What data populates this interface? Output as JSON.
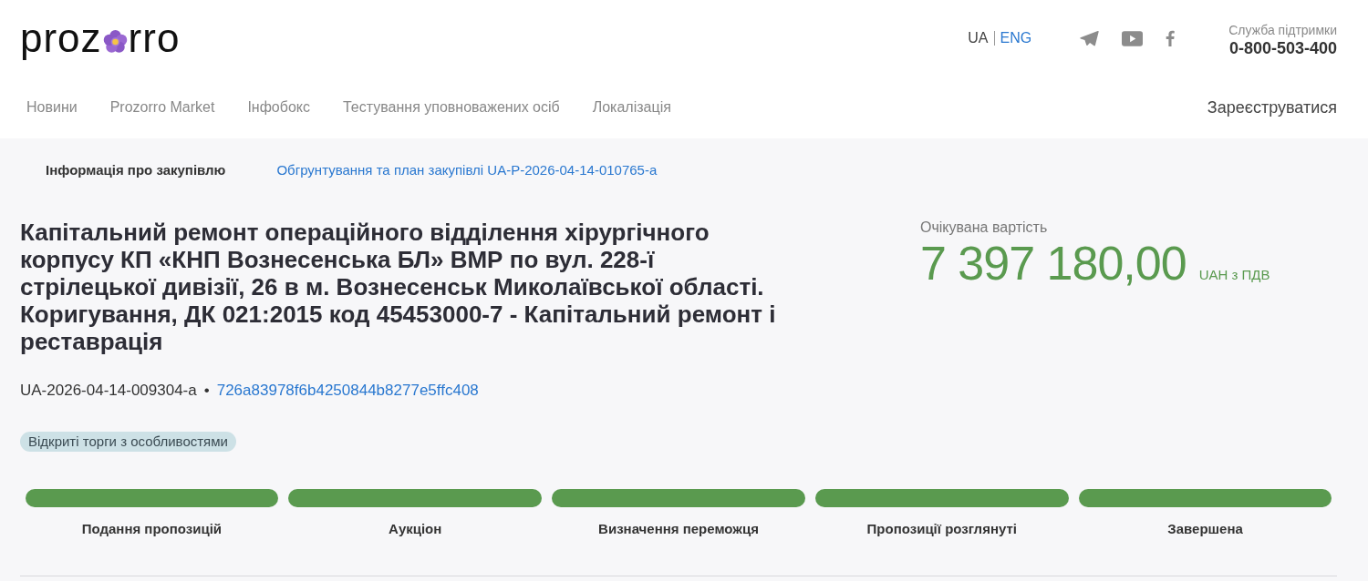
{
  "header": {
    "logo": {
      "text_start": "proz",
      "text_end": "rro"
    },
    "languages": [
      {
        "label": "UA",
        "selected": true
      },
      {
        "label": "ENG",
        "selected": false
      }
    ],
    "support": {
      "label": "Служба підтримки",
      "phone": "0-800-503-400"
    },
    "nav": [
      "Новини",
      "Prozorro Market",
      "Інфобокс",
      "Тестування уповноважених осіб",
      "Локалізація"
    ],
    "register": "Зареєструватися"
  },
  "tabs": [
    {
      "label": "Інформація про закупівлю",
      "selected": true
    },
    {
      "label": "Обгрунтування та план закупівлі UA-P-2026-04-14-010765-a",
      "selected": false
    }
  ],
  "tender": {
    "title": "Капітальний ремонт операційного відділення хірургічного корпусу КП «КНП Вознесенська БЛ» ВМР по вул. 228-ї стрілецької дивізії, 26 в м. Вознесенськ Миколаївської області. Коригування, ДК 021:2015 код 45453000-7 - Капітальний ремонт і реставрація",
    "id": "UA-2026-04-14-009304-a",
    "separator": "•",
    "hash": "726a83978f6b4250844b8277e5ffc408",
    "procedure": "Відкриті торги з особливостями"
  },
  "price": {
    "label": "Очікувана вартість",
    "amount": "7 397 180,00",
    "currency": "UAH з ПДВ"
  },
  "stages": [
    {
      "label": "Подання пропозицій",
      "done": true
    },
    {
      "label": "Аукціон",
      "done": true
    },
    {
      "label": "Визначення переможця",
      "done": true
    },
    {
      "label": "Пропозиції розглянуті",
      "done": true
    },
    {
      "label": "Завершена",
      "done": true
    }
  ]
}
